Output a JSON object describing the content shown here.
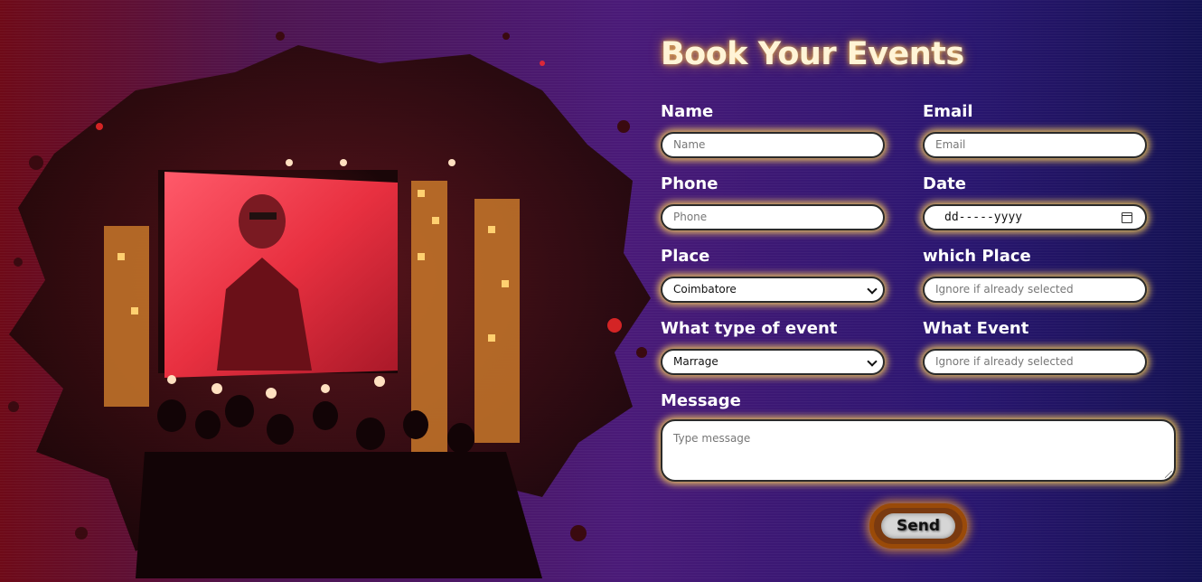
{
  "form": {
    "title": "Book Your Events",
    "name": {
      "label": "Name",
      "placeholder": "Name"
    },
    "email": {
      "label": "Email",
      "placeholder": "Email"
    },
    "phone": {
      "label": "Phone",
      "placeholder": "Phone"
    },
    "date": {
      "label": "Date",
      "value": "dd-----yyyy"
    },
    "place": {
      "label": "Place",
      "selected": "Coimbatore"
    },
    "which_place": {
      "label": "which Place",
      "placeholder": "Ignore if already selected"
    },
    "event_type": {
      "label": "What type of event",
      "selected": "Marrage"
    },
    "what_event": {
      "label": "What Event",
      "placeholder": "Ignore if already selected"
    },
    "message": {
      "label": "Message",
      "placeholder": "Type message"
    },
    "send_label": "Send"
  },
  "colors": {
    "glow": "#ffd25a",
    "send_ring": "#9a4a08",
    "bg_left": "#6e0a18",
    "bg_right": "#141253"
  }
}
